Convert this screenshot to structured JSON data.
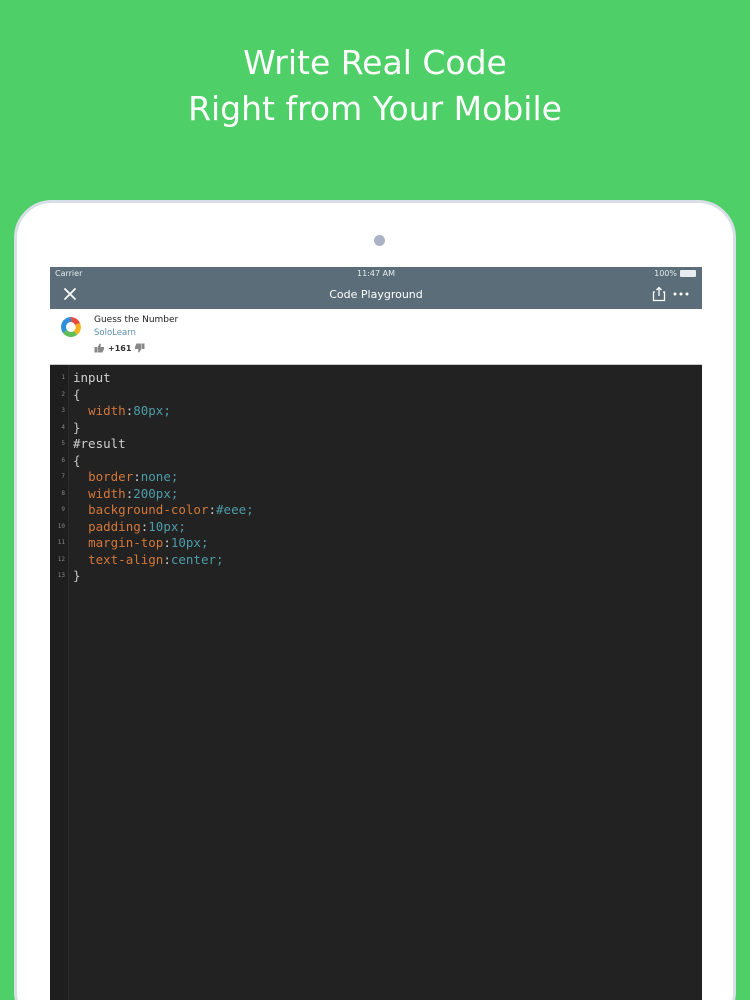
{
  "headline": {
    "line1": "Write Real Code",
    "line2": "Right from Your Mobile"
  },
  "colors": {
    "background": "#4fcf68",
    "toolbar": "#5a6d78",
    "editor_bg": "#222222",
    "property": "#d3773a",
    "value": "#4e9ca8"
  },
  "status_bar": {
    "carrier": "Carrier",
    "time": "11:47 AM",
    "battery": "100%"
  },
  "toolbar": {
    "title": "Code Playground",
    "close_icon": "close-icon",
    "share_icon": "share-icon",
    "more_icon": "more-icon"
  },
  "code_info": {
    "title": "Guess the Number",
    "author": "SoloLearn",
    "votes": "+161"
  },
  "editor": {
    "lines": [
      {
        "n": "1",
        "sel": "input",
        "prop": "",
        "colon": "",
        "val": ""
      },
      {
        "n": "2",
        "sel": "{",
        "prop": "",
        "colon": "",
        "val": ""
      },
      {
        "n": "3",
        "sel": "  ",
        "prop": "width",
        "colon": ":",
        "val": "80px;"
      },
      {
        "n": "4",
        "sel": "}",
        "prop": "",
        "colon": "",
        "val": ""
      },
      {
        "n": "5",
        "sel": "#result",
        "prop": "",
        "colon": "",
        "val": ""
      },
      {
        "n": "6",
        "sel": "{",
        "prop": "",
        "colon": "",
        "val": ""
      },
      {
        "n": "7",
        "sel": "  ",
        "prop": "border",
        "colon": ":",
        "val": "none;"
      },
      {
        "n": "8",
        "sel": "  ",
        "prop": "width",
        "colon": ":",
        "val": "200px;"
      },
      {
        "n": "9",
        "sel": "  ",
        "prop": "background-color",
        "colon": ":",
        "val": "#eee;"
      },
      {
        "n": "10",
        "sel": "  ",
        "prop": "padding",
        "colon": ":",
        "val": "10px;"
      },
      {
        "n": "11",
        "sel": "  ",
        "prop": "margin-top",
        "colon": ":",
        "val": "10px;"
      },
      {
        "n": "12",
        "sel": "  ",
        "prop": "text-align",
        "colon": ":",
        "val": "center;"
      },
      {
        "n": "13",
        "sel": "}",
        "prop": "",
        "colon": "",
        "val": ""
      }
    ]
  }
}
